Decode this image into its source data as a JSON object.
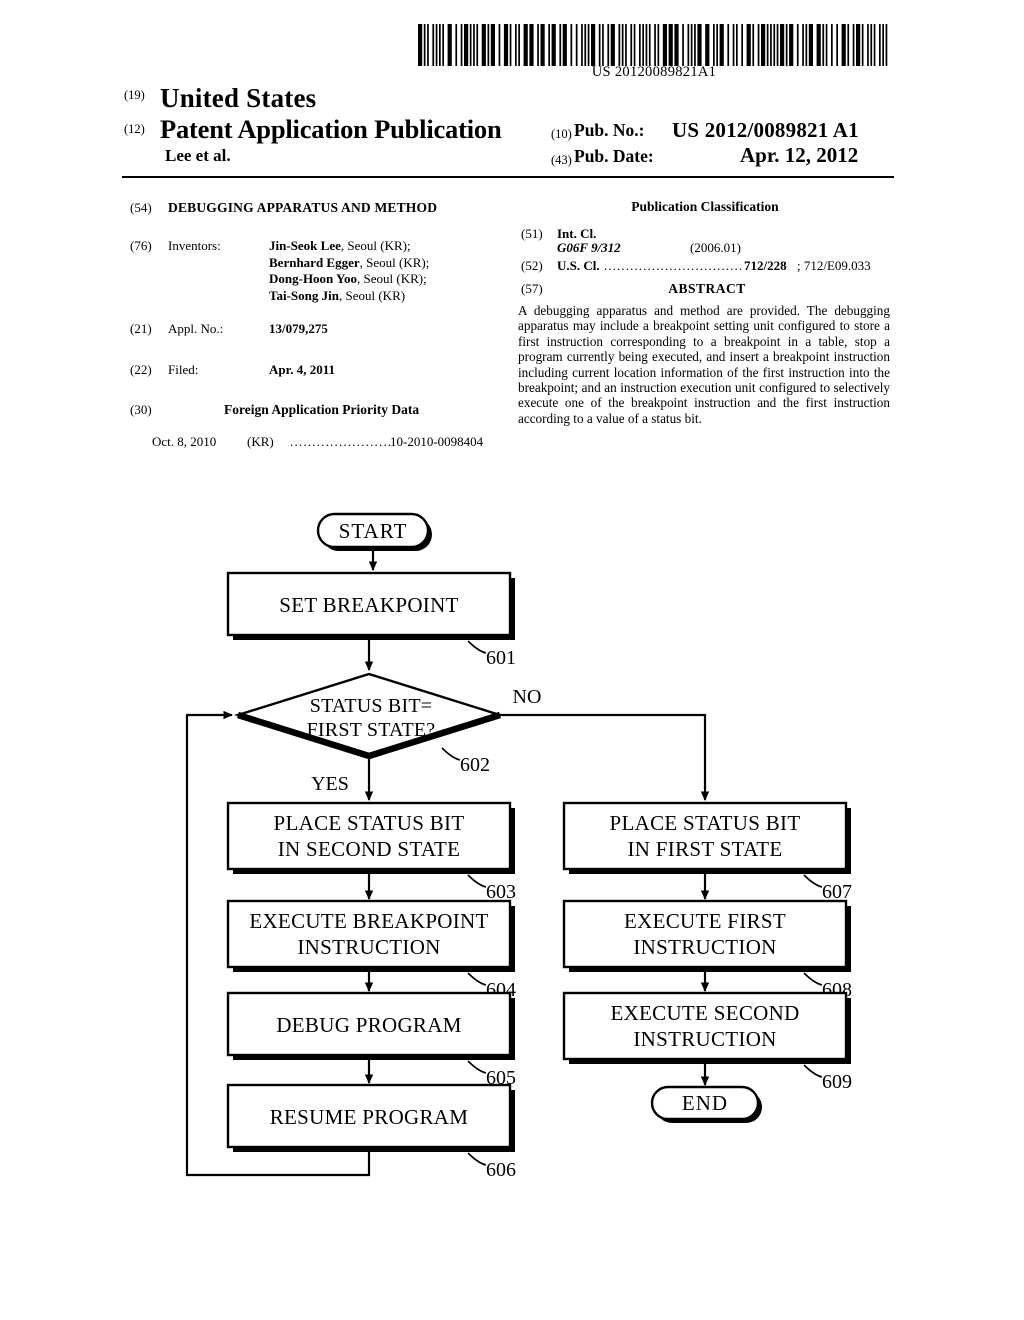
{
  "barcode": {
    "number": "US 20120089821A1"
  },
  "masthead": {
    "code_19": "(19)",
    "country": "United States",
    "code_12": "(12)",
    "doc_type": "Patent Application Publication",
    "authors": "Lee et al.",
    "code_10": "(10)",
    "pub_no_label": "Pub. No.:",
    "pub_no_value": "US 2012/0089821 A1",
    "code_43": "(43)",
    "pub_date_label": "Pub. Date:",
    "pub_date_value": "Apr. 12, 2012"
  },
  "biblio": {
    "title_code": "(54)",
    "title": "DEBUGGING APPARATUS AND METHOD",
    "inventors_code": "(76)",
    "inventors_label": "Inventors:",
    "inventors": [
      {
        "name": "Jin-Seok Lee",
        "location": ", Seoul (KR);"
      },
      {
        "name": "Bernhard Egger",
        "location": ", Seoul (KR);"
      },
      {
        "name": "Dong-Hoon Yoo",
        "location": ", Seoul (KR);"
      },
      {
        "name": "Tai-Song Jin",
        "location": ", Seoul (KR)"
      }
    ],
    "appl_no_code": "(21)",
    "appl_no_label": "Appl. No.:",
    "appl_no_value": "13/079,275",
    "filed_code": "(22)",
    "filed_label": "Filed:",
    "filed_value": "Apr. 4, 2011",
    "priority_code": "(30)",
    "priority_title": "Foreign Application Priority Data",
    "priority_date": "Oct. 8, 2010",
    "priority_country": "(KR)",
    "priority_dots": ".......................",
    "priority_number": "10-2010-0098404"
  },
  "classification": {
    "heading": "Publication Classification",
    "int_cl_code": "(51)",
    "int_cl_label": "Int. Cl.",
    "int_cl_value": "G06F  9/312",
    "int_cl_version": "(2006.01)",
    "us_cl_code": "(52)",
    "us_cl_label": "U.S. Cl.",
    "us_cl_dots": "................................",
    "us_cl_main": "712/228",
    "us_cl_sub": "; 712/E09.033",
    "abstract_code": "(57)",
    "abstract_title": "ABSTRACT",
    "abstract_text": "A debugging apparatus and method are provided. The debugging apparatus may include a breakpoint setting unit configured to store a first instruction corresponding to a breakpoint in a table, stop a program currently being executed, and insert a breakpoint instruction including current location information of the first instruction into the breakpoint; and an instruction execution unit configured to selectively execute one of the breakpoint instruction and the first instruction according to a value of a status bit."
  },
  "flowchart": {
    "start_label": "START",
    "end_label": "END",
    "yes_label": "YES",
    "no_label": "NO",
    "decision": {
      "line1": "STATUS BIT=",
      "line2": "FIRST STATE?",
      "ref": "602"
    },
    "nodes": [
      {
        "id": "n601",
        "line1": "SET BREAKPOINT",
        "line2": "",
        "ref": "601"
      },
      {
        "id": "n603",
        "line1": "PLACE STATUS BIT",
        "line2": "IN SECOND STATE",
        "ref": "603"
      },
      {
        "id": "n604",
        "line1": "EXECUTE BREAKPOINT",
        "line2": "INSTRUCTION",
        "ref": "604"
      },
      {
        "id": "n605",
        "line1": "DEBUG PROGRAM",
        "line2": "",
        "ref": "605"
      },
      {
        "id": "n606",
        "line1": "RESUME PROGRAM",
        "line2": "",
        "ref": "606"
      },
      {
        "id": "n607",
        "line1": "PLACE STATUS BIT",
        "line2": "IN FIRST STATE",
        "ref": "607"
      },
      {
        "id": "n608",
        "line1": "EXECUTE FIRST",
        "line2": "INSTRUCTION",
        "ref": "608"
      },
      {
        "id": "n609",
        "line1": "EXECUTE SECOND",
        "line2": "INSTRUCTION",
        "ref": "609"
      }
    ]
  }
}
